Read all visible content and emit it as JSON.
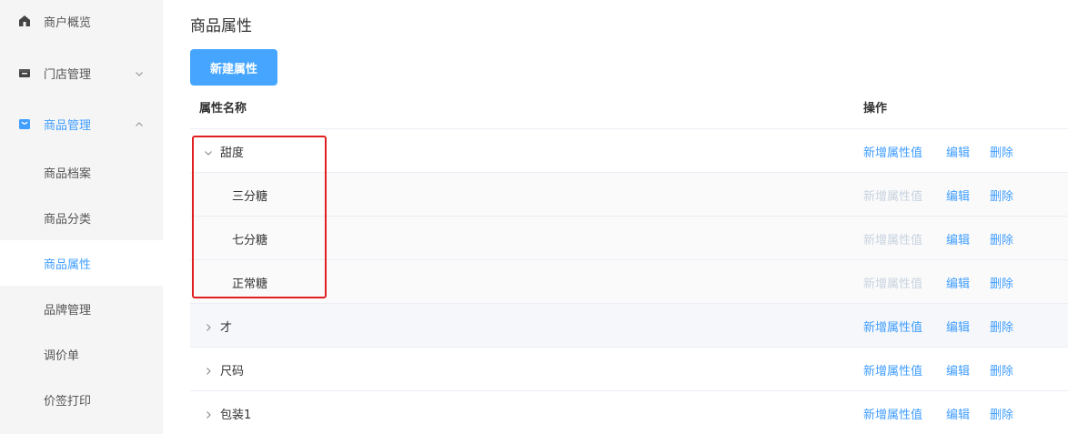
{
  "sidebar": {
    "items": [
      {
        "label": "商户概览",
        "icon": "home-icon"
      },
      {
        "label": "门店管理",
        "icon": "store-icon"
      },
      {
        "label": "商品管理",
        "icon": "bag-icon"
      }
    ],
    "sub_items": [
      {
        "label": "商品档案"
      },
      {
        "label": "商品分类"
      },
      {
        "label": "商品属性"
      },
      {
        "label": "品牌管理"
      },
      {
        "label": "调价单"
      },
      {
        "label": "价签打印"
      }
    ],
    "selected": "商品属性"
  },
  "page": {
    "title": "商品属性",
    "new_button": "新建属性"
  },
  "table": {
    "headers": {
      "name": "属性名称",
      "ops": "操作"
    },
    "op_labels": {
      "add": "新增属性值",
      "edit": "编辑",
      "delete": "删除"
    },
    "rows": [
      {
        "name": "甜度",
        "expanded": true,
        "children": [
          "三分糖",
          "七分糖",
          "正常糖"
        ]
      },
      {
        "name": "才",
        "expanded": false
      },
      {
        "name": "尺码",
        "expanded": false
      },
      {
        "name": "包装1",
        "expanded": false
      }
    ]
  },
  "colors": {
    "accent": "#409eff",
    "button": "#46a6ff",
    "highlight": "#e02020",
    "disabled": "#c8d3e0"
  }
}
